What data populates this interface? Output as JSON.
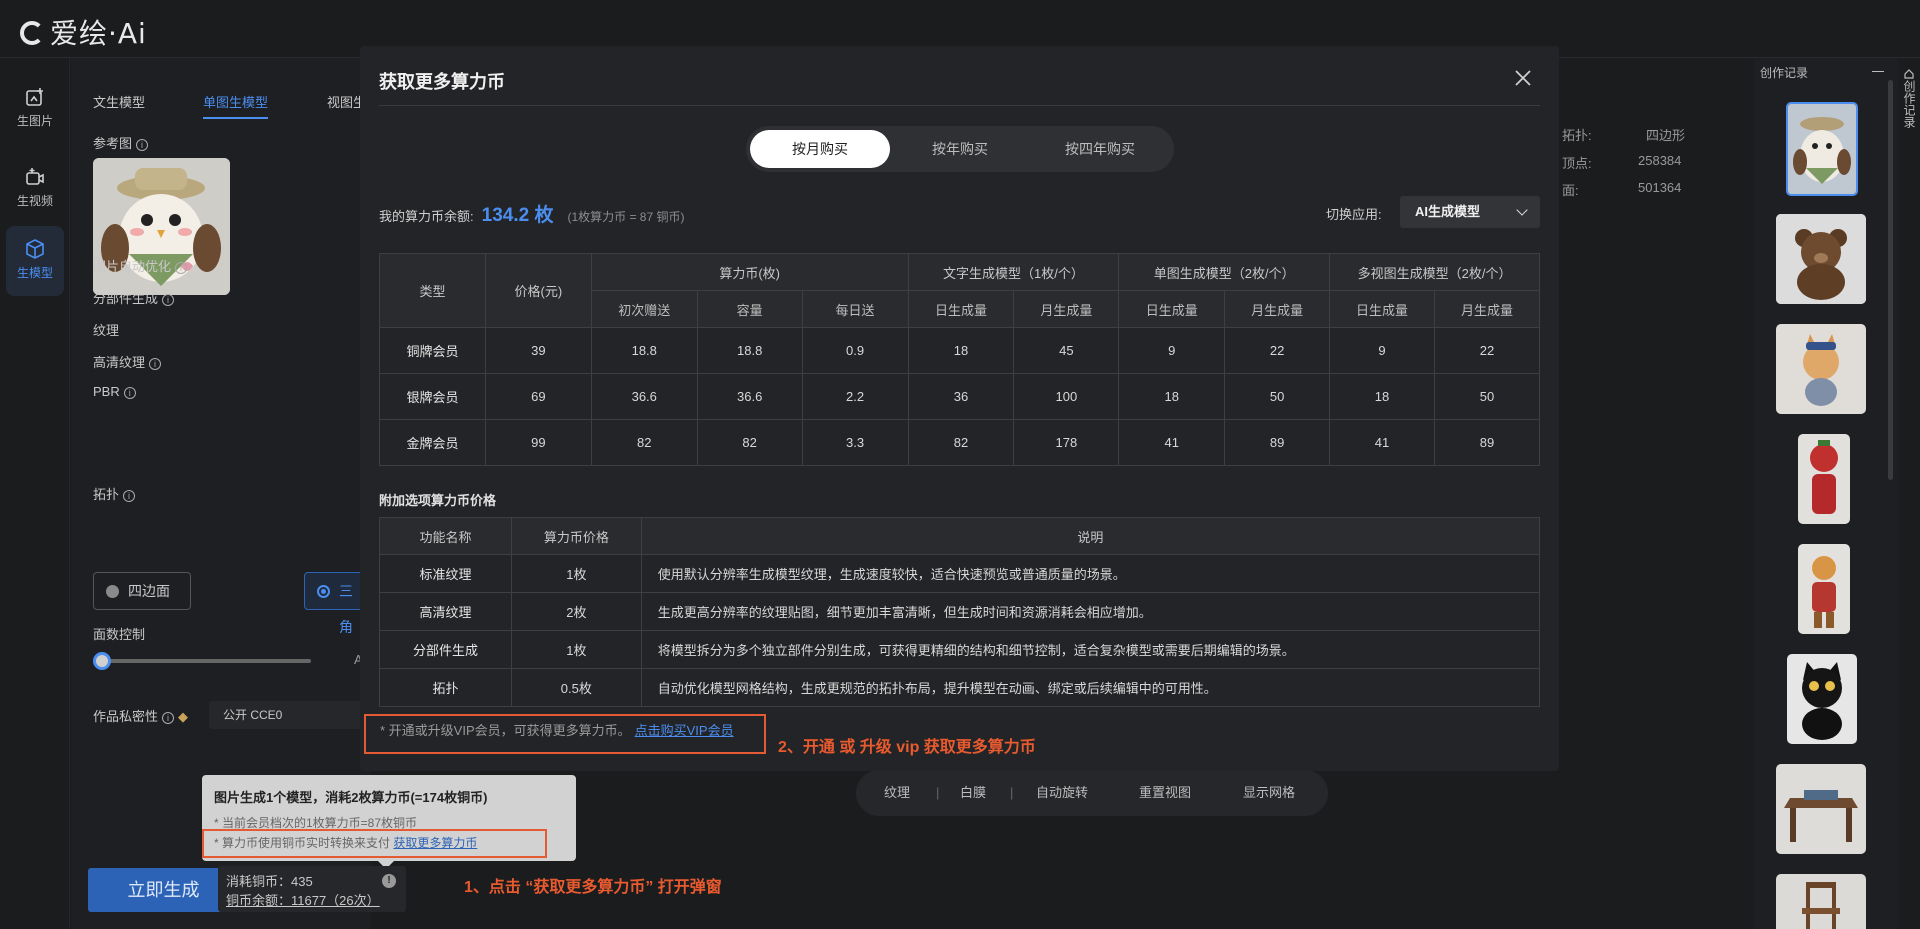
{
  "app": {
    "logo_text": "爱绘·Ai"
  },
  "leftnav": [
    {
      "label": "生图片",
      "icon": "image-add-icon"
    },
    {
      "label": "生视频",
      "icon": "video-add-icon"
    },
    {
      "label": "生模型",
      "icon": "cube-icon",
      "active": true
    }
  ],
  "panel": {
    "tabs": [
      "文生模型",
      "单图生模型",
      "视图生"
    ],
    "active_tab": "单图生模型",
    "ref_label": "参考图",
    "opt_auto": "图片自动优化",
    "opt_parts": "分部件生成",
    "opt_texture": "纹理",
    "opt_hd_texture": "高清纹理",
    "opt_pbr": "PBR",
    "topology_label": "拓扑",
    "topology_quad": "四边面",
    "topology_tri": "三角",
    "faces_label": "面数控制",
    "faces_value_prefix": "A",
    "faces_level": 0.0,
    "privacy_label": "作品私密性",
    "privacy_value": "公开 CCE0",
    "generate_label": "立即生成",
    "cost_line1": "消耗铜币：435",
    "cost_line2": "铜币余额：11677（26次）"
  },
  "tooltip": {
    "line1": "图片生成1个模型，消耗2枚算力币(=174枚铜币)",
    "line2": "* 当前会员档次的1枚算力币=87枚铜币",
    "line3_prefix": "* 算力币使用铜币实时转换来支付",
    "line3_link": "获取更多算力币"
  },
  "annotations": {
    "step1": "1、点击  “获取更多算力币” 打开弹窗",
    "step2": "2、开通 或 升级 vip 获取更多算力币"
  },
  "stage_info": [
    {
      "key": "拓扑:",
      "val": "四边形"
    },
    {
      "key": "顶点:",
      "val": "258384"
    },
    {
      "key": "面:",
      "val": "501364"
    }
  ],
  "toolbar3d": [
    "纹理",
    "|",
    "白膜",
    "|",
    "自动旋转",
    "重置视图",
    "显示网格"
  ],
  "history": {
    "title": "创作记录",
    "side_tab": "创作记录",
    "items": [
      "owl-plush",
      "teddy-bear",
      "cat-figure",
      "strawberry-doll",
      "monkey-king",
      "black-cat",
      "wooden-table",
      "wooden-chair"
    ]
  },
  "modal": {
    "title": "获取更多算力币",
    "segments": [
      "按月购买",
      "按年购买",
      "按四年购买"
    ],
    "active_segment": "按月购买",
    "balance_label": "我的算力币余额:",
    "balance_value": "134.2 枚",
    "balance_note": "(1枚算力币 = 87 铜币)",
    "switch_label": "切换应用:",
    "switch_value": "AI生成模型",
    "table1": {
      "header_type": "类型",
      "header_price": "价格(元)",
      "group_coin": "算力币(枚)",
      "group_text": "文字生成模型（1枚/个）",
      "group_single": "单图生成模型（2枚/个）",
      "group_multi": "多视图生成模型（2枚/个）",
      "sub": [
        "初次赠送",
        "容量",
        "每日送",
        "日生成量",
        "月生成量",
        "日生成量",
        "月生成量",
        "日生成量",
        "月生成量"
      ],
      "rows": [
        [
          "铜牌会员",
          "39",
          "18.8",
          "18.8",
          "0.9",
          "18",
          "45",
          "9",
          "22",
          "9",
          "22"
        ],
        [
          "银牌会员",
          "69",
          "36.6",
          "36.6",
          "2.2",
          "36",
          "100",
          "18",
          "50",
          "18",
          "50"
        ],
        [
          "金牌会员",
          "99",
          "82",
          "82",
          "3.3",
          "82",
          "178",
          "41",
          "89",
          "41",
          "89"
        ]
      ]
    },
    "addon_title": "附加选项算力币价格",
    "table2": {
      "headers": [
        "功能名称",
        "算力币价格",
        "说明"
      ],
      "rows": [
        [
          "标准纹理",
          "1枚",
          "使用默认分辨率生成模型纹理，生成速度较快，适合快速预览或普通质量的场景。"
        ],
        [
          "高清纹理",
          "2枚",
          "生成更高分辨率的纹理贴图，细节更加丰富清晰，但生成时间和资源消耗会相应增加。"
        ],
        [
          "分部件生成",
          "1枚",
          "将模型拆分为多个独立部件分别生成，可获得更精细的结构和细节控制，适合复杂模型或需要后期编辑的场景。"
        ],
        [
          "拓扑",
          "0.5枚",
          "自动优化模型网格结构，生成更规范的拓扑布局，提升模型在动画、绑定或后续编辑中的可用性。"
        ]
      ]
    },
    "vip_note": "* 开通或升级VIP会员，可获得更多算力币。",
    "vip_link": "点击购买VIP会员"
  }
}
